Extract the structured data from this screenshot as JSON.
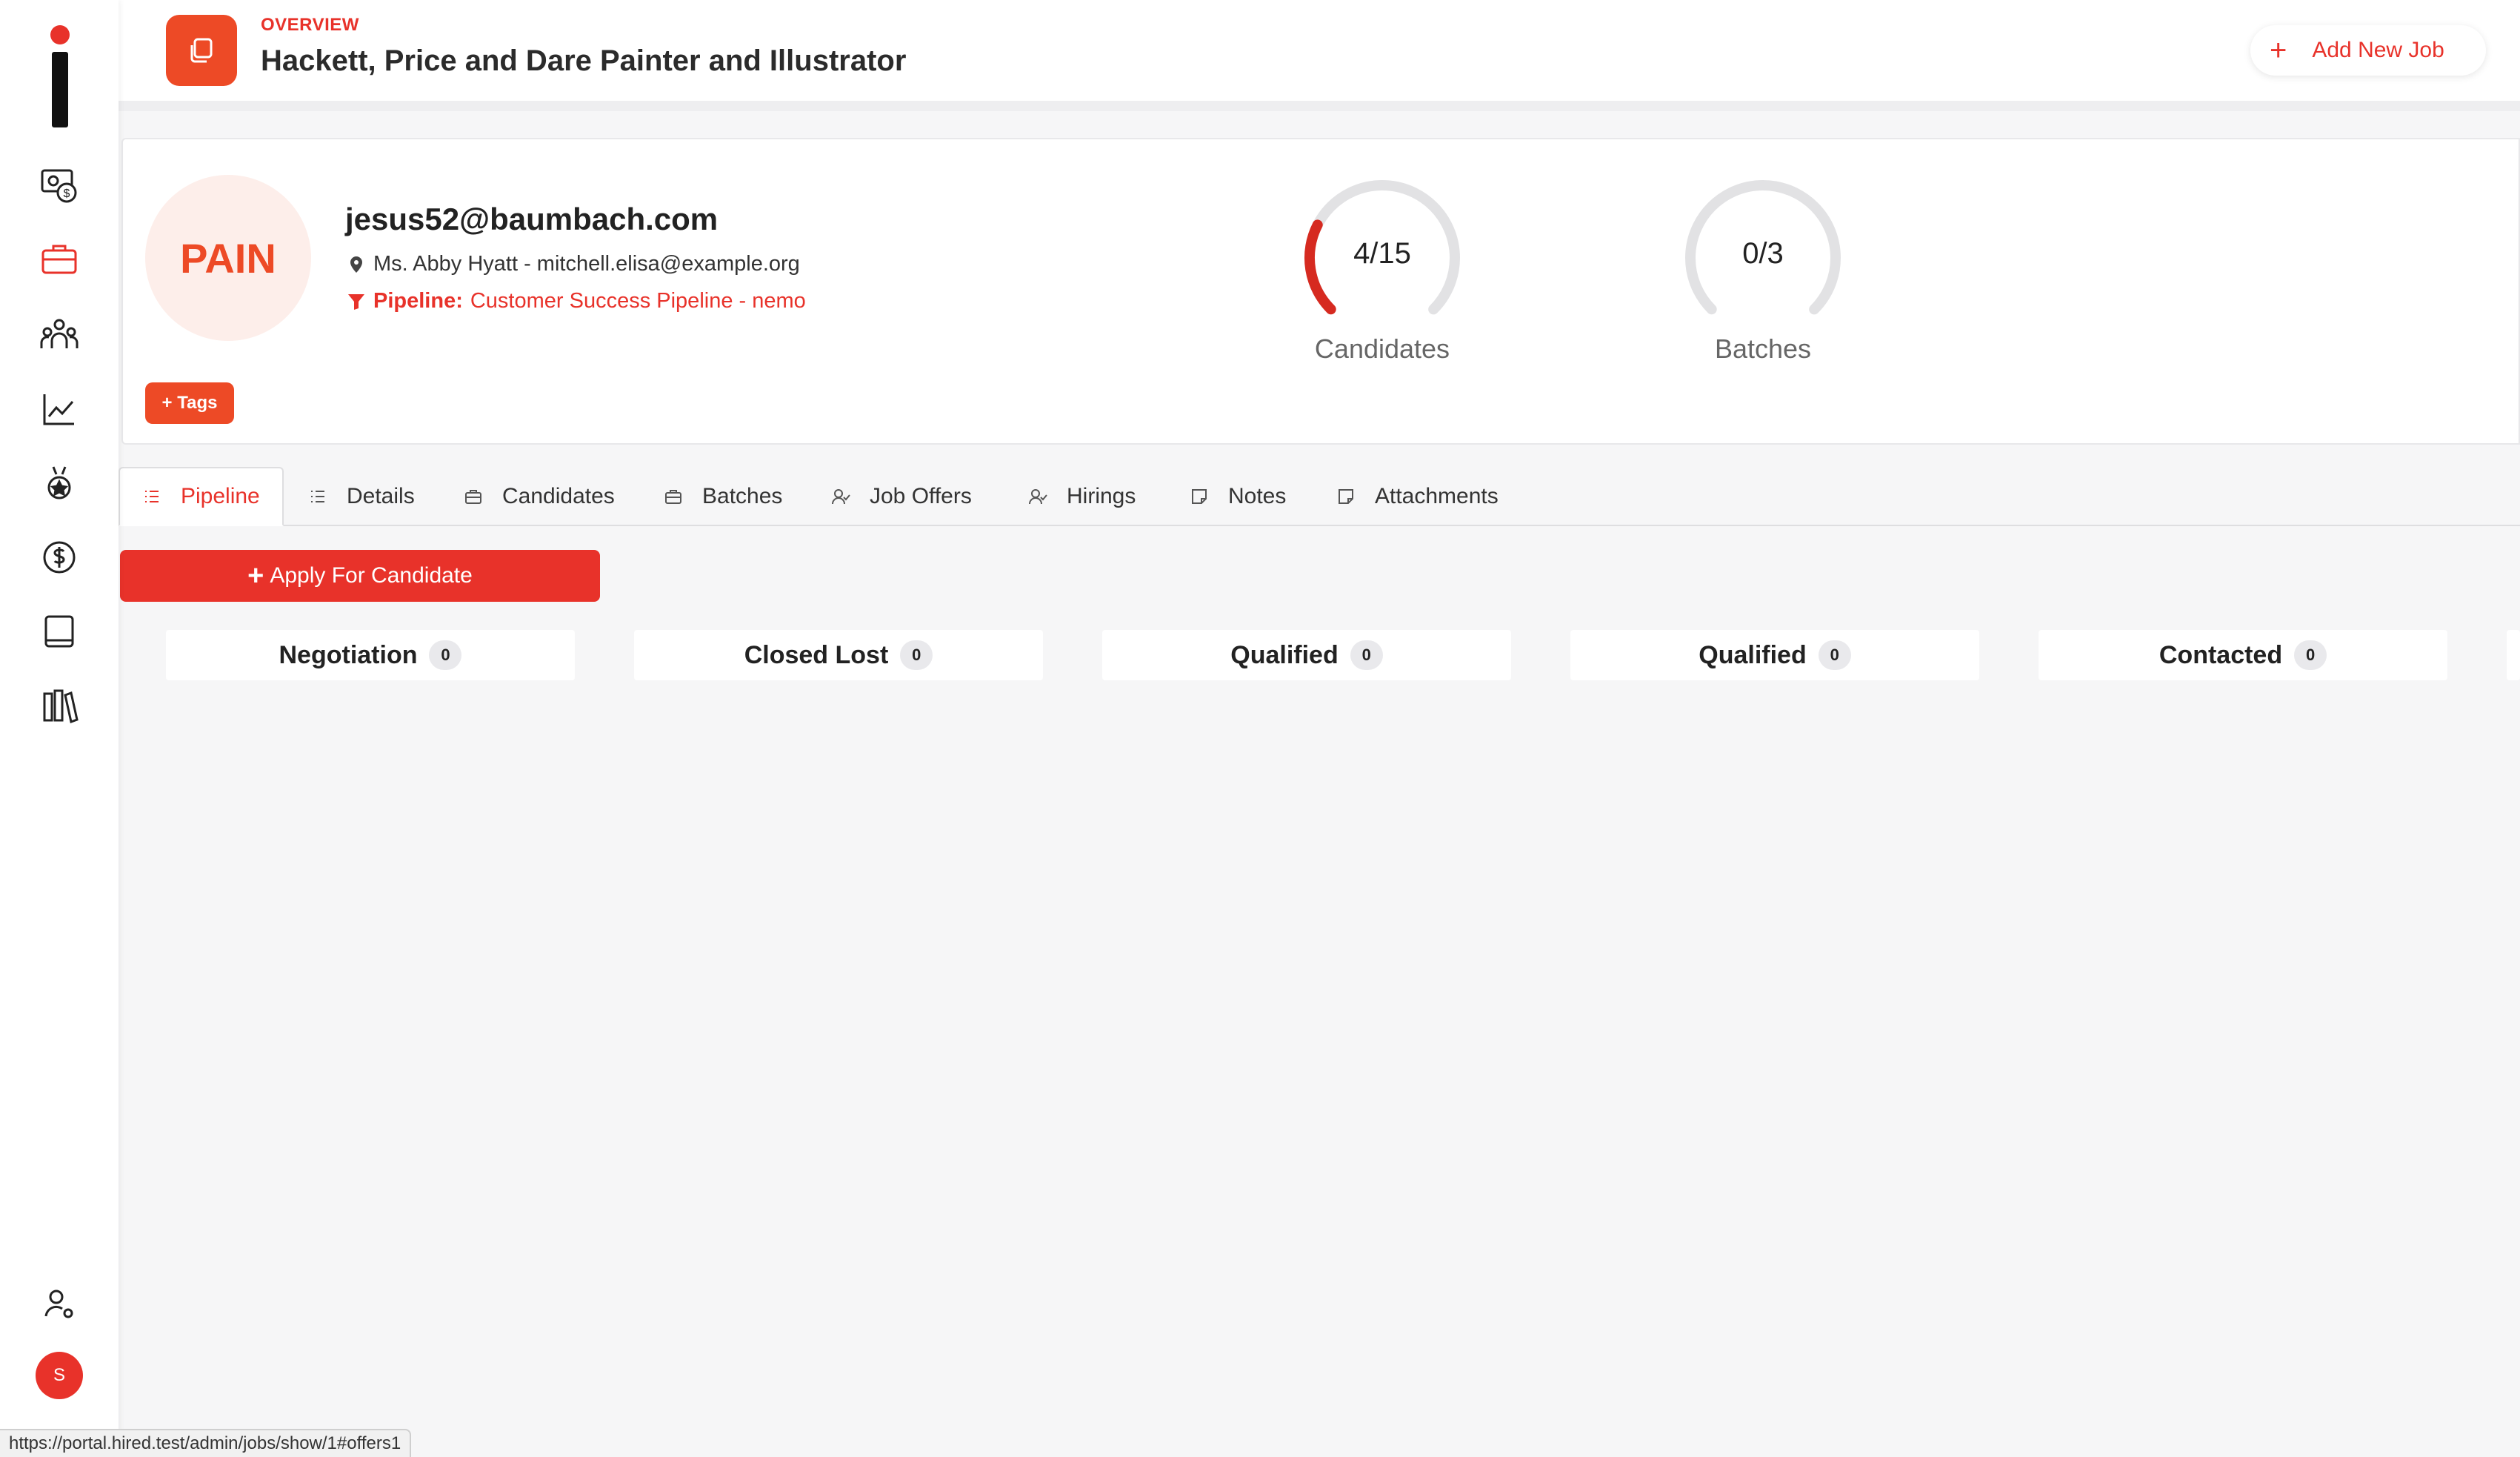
{
  "header": {
    "overview_label": "OVERVIEW",
    "title": "Hackett, Price and Dare Painter and Illustrator",
    "add_button_label": "Add New Job",
    "add_button_icon": "plus-icon"
  },
  "sidebar": {
    "items": [
      {
        "icon": "money-icon"
      },
      {
        "icon": "briefcase-icon",
        "active": true
      },
      {
        "icon": "people-icon"
      },
      {
        "icon": "chart-icon"
      },
      {
        "icon": "medal-icon"
      },
      {
        "icon": "dollar-icon"
      },
      {
        "icon": "book-icon"
      },
      {
        "icon": "library-icon"
      }
    ],
    "settings_icon": "user-settings-icon",
    "avatar_initial": "S"
  },
  "summary": {
    "badge": "PAIN",
    "email": "jesus52@baumbach.com",
    "contact": "Ms. Abby Hyatt - mitchell.elisa@example.org",
    "pipeline_label": "Pipeline:",
    "pipeline_value": "Customer Success Pipeline - nemo",
    "tags_button": "+ Tags",
    "gauges": [
      {
        "value_text": "4/15",
        "label": "Candidates",
        "fraction": 0.2667
      },
      {
        "value_text": "0/3",
        "label": "Batches",
        "fraction": 0
      }
    ]
  },
  "tabs": [
    {
      "label": "Pipeline",
      "icon": "list-icon",
      "active": true
    },
    {
      "label": "Details",
      "icon": "list-icon"
    },
    {
      "label": "Candidates",
      "icon": "briefcase-icon"
    },
    {
      "label": "Batches",
      "icon": "briefcase-icon"
    },
    {
      "label": "Job Offers",
      "icon": "user-check-icon"
    },
    {
      "label": "Hirings",
      "icon": "user-check-icon"
    },
    {
      "label": "Notes",
      "icon": "note-icon"
    },
    {
      "label": "Attachments",
      "icon": "note-icon"
    }
  ],
  "apply_button": "Apply For Candidate",
  "pipeline_columns": [
    {
      "name": "Negotiation",
      "count": "0"
    },
    {
      "name": "Closed Lost",
      "count": "0"
    },
    {
      "name": "Qualified",
      "count": "0"
    },
    {
      "name": "Qualified",
      "count": "0"
    },
    {
      "name": "Contacted",
      "count": "0"
    }
  ],
  "status_bar_url": "https://portal.hired.test/admin/jobs/show/1#offers1",
  "colors": {
    "accent": "#e8322a",
    "accent_orange": "#ed4a26",
    "background": "#f6f6f7"
  }
}
